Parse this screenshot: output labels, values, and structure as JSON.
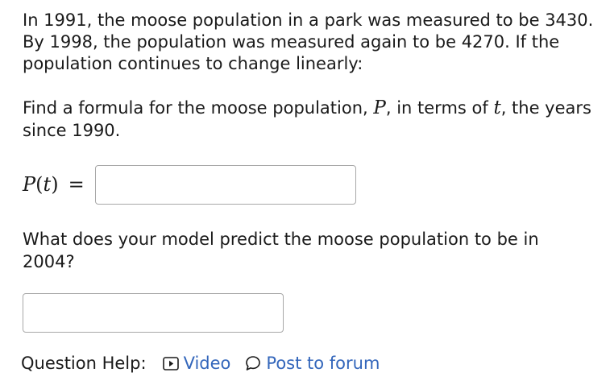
{
  "problem": {
    "statement": "In 1991, the moose population in a park was measured to be 3430. By 1998, the population was measured again to be 4270. If the population continues to change linearly:"
  },
  "question1": {
    "text_before": "Find a formula for the moose population, ",
    "var_p": "P",
    "text_middle": ", in terms of ",
    "var_t": "t",
    "text_after": ", the years since 1990."
  },
  "answer1": {
    "lhs_function": "P",
    "lhs_argument": "t",
    "lhs_equals": "=",
    "value": ""
  },
  "question2": {
    "text": "What does your model predict the moose population to be in 2004?"
  },
  "answer2": {
    "value": ""
  },
  "help": {
    "label": "Question Help:",
    "video_label": "Video",
    "forum_label": "Post to forum",
    "video_icon": "video-play-icon",
    "forum_icon": "speech-bubble-icon",
    "link_color": "#3366bb"
  }
}
